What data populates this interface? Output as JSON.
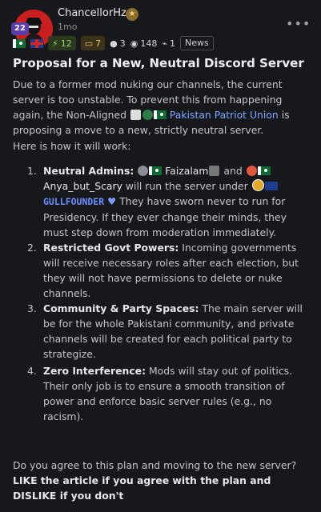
{
  "post": {
    "author": "ChancellorHz",
    "level": "22",
    "time": "1mo",
    "stats": {
      "green_value": "12",
      "gold_value": "7",
      "comments": "3",
      "views": "148",
      "reposts": "1",
      "category": "News"
    },
    "title": "Proposal for a New, Neutral Discord Server",
    "intro_1": "Due to a former mod nuking our channels, the current server is too unstable. To prevent this from happening again, the Non-Aligned",
    "party_name": "Pakistan Patriot Union",
    "intro_2": "is proposing a move to a new, strictly neutral server.",
    "how_heading": "Here is how it will work:",
    "points": [
      {
        "number": "1.",
        "heading": "Neutral Admins:",
        "admin_1": "Faizalam",
        "and_word": "and",
        "admin_2": "Anya_but_Scary",
        "mid_text": "will run the server under",
        "admin_3": "GULLFOUNDER",
        "rest": "They have sworn never to run for Presidency. If they ever change their minds, they must step down from moderation immediately."
      },
      {
        "number": "2.",
        "heading": "Restricted Govt Powers:",
        "rest": "Incoming governments will receive necessary roles after each election, but they will not have permissions to delete or nuke channels."
      },
      {
        "number": "3.",
        "heading": "Community & Party Spaces:",
        "rest": "The main server will be for the whole Pakistani community, and private channels will be created for each political party to strategize."
      },
      {
        "number": "4.",
        "heading": "Zero Interference:",
        "rest": "Mods will stay out of politics. Their only job is to ensure a smooth transition of power and enforce basic server rules (e.g., no racism)."
      }
    ],
    "question": "Do you agree to this plan and moving to the new server?",
    "cta": "LIKE the article if you agree with the plan and DISLIKE if you don't"
  },
  "icons": {
    "more": "more-options-icon",
    "comments": "comment-icon",
    "views": "eye-icon",
    "reposts": "repost-icon"
  },
  "colors": {
    "background": "#17181c",
    "link": "#7aa9ff",
    "avatar_bg": "#c91f1f"
  }
}
